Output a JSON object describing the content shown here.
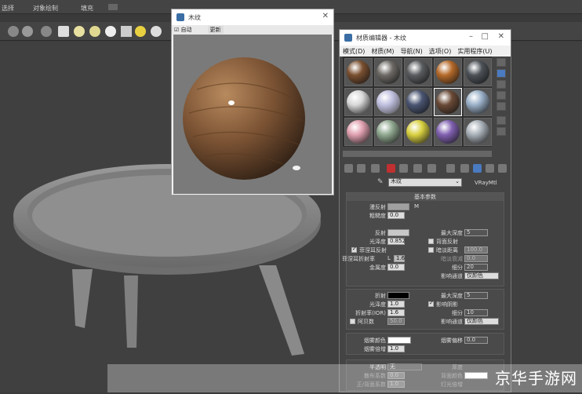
{
  "menubar": {
    "items": [
      "选择",
      "对象绘制",
      "填充"
    ]
  },
  "preview_window": {
    "title": "木纹",
    "auto_label": "自动",
    "update_label": "更新"
  },
  "material_editor": {
    "title": "材质编辑器 - 木纹",
    "menu": [
      "模式(D)",
      "材质(M)",
      "导航(N)",
      "选项(O)",
      "实用程序(U)"
    ],
    "material_name": "木纹",
    "material_type": "VRayMtl",
    "rollout_title": "基本参数",
    "diffuse": {
      "label": "漫反射",
      "m_label": "M",
      "roughness_label": "粗糙度",
      "roughness": "0.0"
    },
    "reflection": {
      "label": "反射",
      "gloss_label": "光泽度",
      "gloss": "0.852",
      "fresnel_label": "菲涅耳反射",
      "fresnel_ior_label": "菲涅耳折射率",
      "fresnel_ior_l": "L",
      "fresnel_ior": "1.6",
      "metal_label": "金属度",
      "metal": "0.0",
      "max_depth_label": "最大深度",
      "max_depth": "5",
      "back_refl_label": "背面反射",
      "dim_dist_label": "暗淡距离",
      "dim_dist": "100.0",
      "dim_falloff_label": "暗淡衰减",
      "dim_falloff": "0.0",
      "subdiv_label": "细分",
      "subdiv": "20",
      "affect_label": "影响通道",
      "affect": "仅颜色"
    },
    "refraction": {
      "label": "折射",
      "gloss_label": "光泽度",
      "gloss": "1.0",
      "ior_label": "折射率(IOR)",
      "ior": "1.6",
      "abbe_label": "阿贝数",
      "abbe": "50.0",
      "max_depth_label": "最大深度",
      "max_depth": "5",
      "affect_shadow_label": "影响阴影",
      "subdiv_label": "细分",
      "subdiv": "10",
      "affect_label": "影响通道",
      "affect": "仅颜色"
    },
    "fog": {
      "color_label": "烟雾颜色",
      "mult_label": "烟雾倍增",
      "mult": "1.0",
      "bias_label": "烟雾偏移",
      "bias": "0.0"
    },
    "translucency": {
      "label": "半透明",
      "dropdown": "无",
      "scatter_label": "散布系数",
      "scatter": "0.0",
      "fb_label": "正/背面系数",
      "fb": "1.0",
      "thickness_label": "厚度",
      "back_color_label": "背面颜色",
      "light_mult_label": "灯光倍增"
    },
    "slot_colors": [
      "#7a5030",
      "#6e6a66",
      "#5a5d60",
      "#b56a2a",
      "#4d5258",
      "#d8d8d8",
      "#c0c0d8",
      "#4a5572",
      "#6a4a36",
      "#9ab0c8",
      "#e0a0b0",
      "#90a890",
      "#d8d040",
      "#8060b0",
      "#a8b0b8"
    ]
  },
  "watermark": "京华手游网"
}
